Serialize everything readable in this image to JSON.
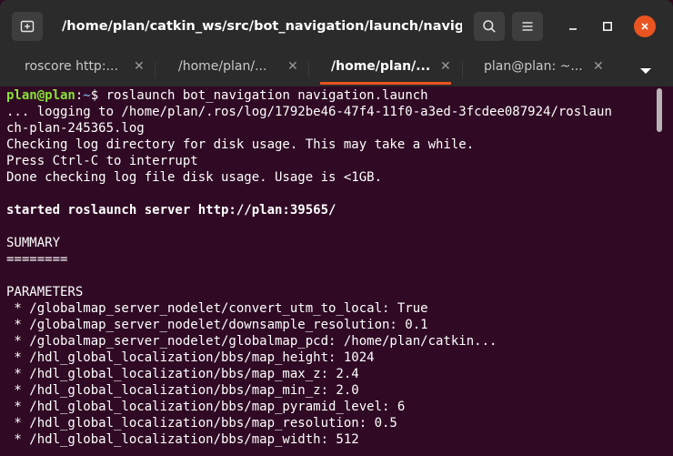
{
  "window": {
    "title": "/home/plan/catkin_ws/src/bot_navigation/launch/navigatio..."
  },
  "tabs": [
    {
      "label": "roscore http:...",
      "active": false
    },
    {
      "label": "/home/plan/...",
      "active": false
    },
    {
      "label": "/home/plan/...",
      "active": true
    },
    {
      "label": "plan@plan: ~...",
      "active": false
    }
  ],
  "icons": {
    "new_tab": "new-tab-icon",
    "search": "search-icon",
    "menu": "hamburger-menu-icon",
    "minimize": "minimize-icon",
    "maximize": "maximize-icon",
    "close": "close-icon",
    "tab_close": "close-icon",
    "tab_dropdown": "chevron-down-icon"
  },
  "colors": {
    "terminal_bg": "#300a24",
    "titlebar_bg": "#2b2b2b",
    "accent": "#e95420",
    "prompt_user": "#8ae234",
    "prompt_path": "#729fcf"
  },
  "terminal": {
    "prompt": {
      "user": "plan@plan",
      "sep": ":",
      "path": "~",
      "symbol": "$ ",
      "command": "roslaunch bot_navigation navigation.launch"
    },
    "lines": [
      {
        "text": "... logging to /home/plan/.ros/log/1792be46-47f4-11f0-a3ed-3fcdee087924/roslaun",
        "bold": false
      },
      {
        "text": "ch-plan-245365.log",
        "bold": false
      },
      {
        "text": "Checking log directory for disk usage. This may take a while.",
        "bold": false
      },
      {
        "text": "Press Ctrl-C to interrupt",
        "bold": false
      },
      {
        "text": "Done checking log file disk usage. Usage is <1GB.",
        "bold": false
      },
      {
        "text": "",
        "bold": false
      },
      {
        "text": "started roslaunch server http://plan:39565/",
        "bold": true
      },
      {
        "text": "",
        "bold": false
      },
      {
        "text": "SUMMARY",
        "bold": false
      },
      {
        "text": "========",
        "bold": false
      },
      {
        "text": "",
        "bold": false
      },
      {
        "text": "PARAMETERS",
        "bold": false
      },
      {
        "text": " * /globalmap_server_nodelet/convert_utm_to_local: True",
        "bold": false
      },
      {
        "text": " * /globalmap_server_nodelet/downsample_resolution: 0.1",
        "bold": false
      },
      {
        "text": " * /globalmap_server_nodelet/globalmap_pcd: /home/plan/catkin...",
        "bold": false
      },
      {
        "text": " * /hdl_global_localization/bbs/map_height: 1024",
        "bold": false
      },
      {
        "text": " * /hdl_global_localization/bbs/map_max_z: 2.4",
        "bold": false
      },
      {
        "text": " * /hdl_global_localization/bbs/map_min_z: 2.0",
        "bold": false
      },
      {
        "text": " * /hdl_global_localization/bbs/map_pyramid_level: 6",
        "bold": false
      },
      {
        "text": " * /hdl_global_localization/bbs/map_resolution: 0.5",
        "bold": false
      },
      {
        "text": " * /hdl_global_localization/bbs/map_width: 512",
        "bold": false
      }
    ]
  }
}
